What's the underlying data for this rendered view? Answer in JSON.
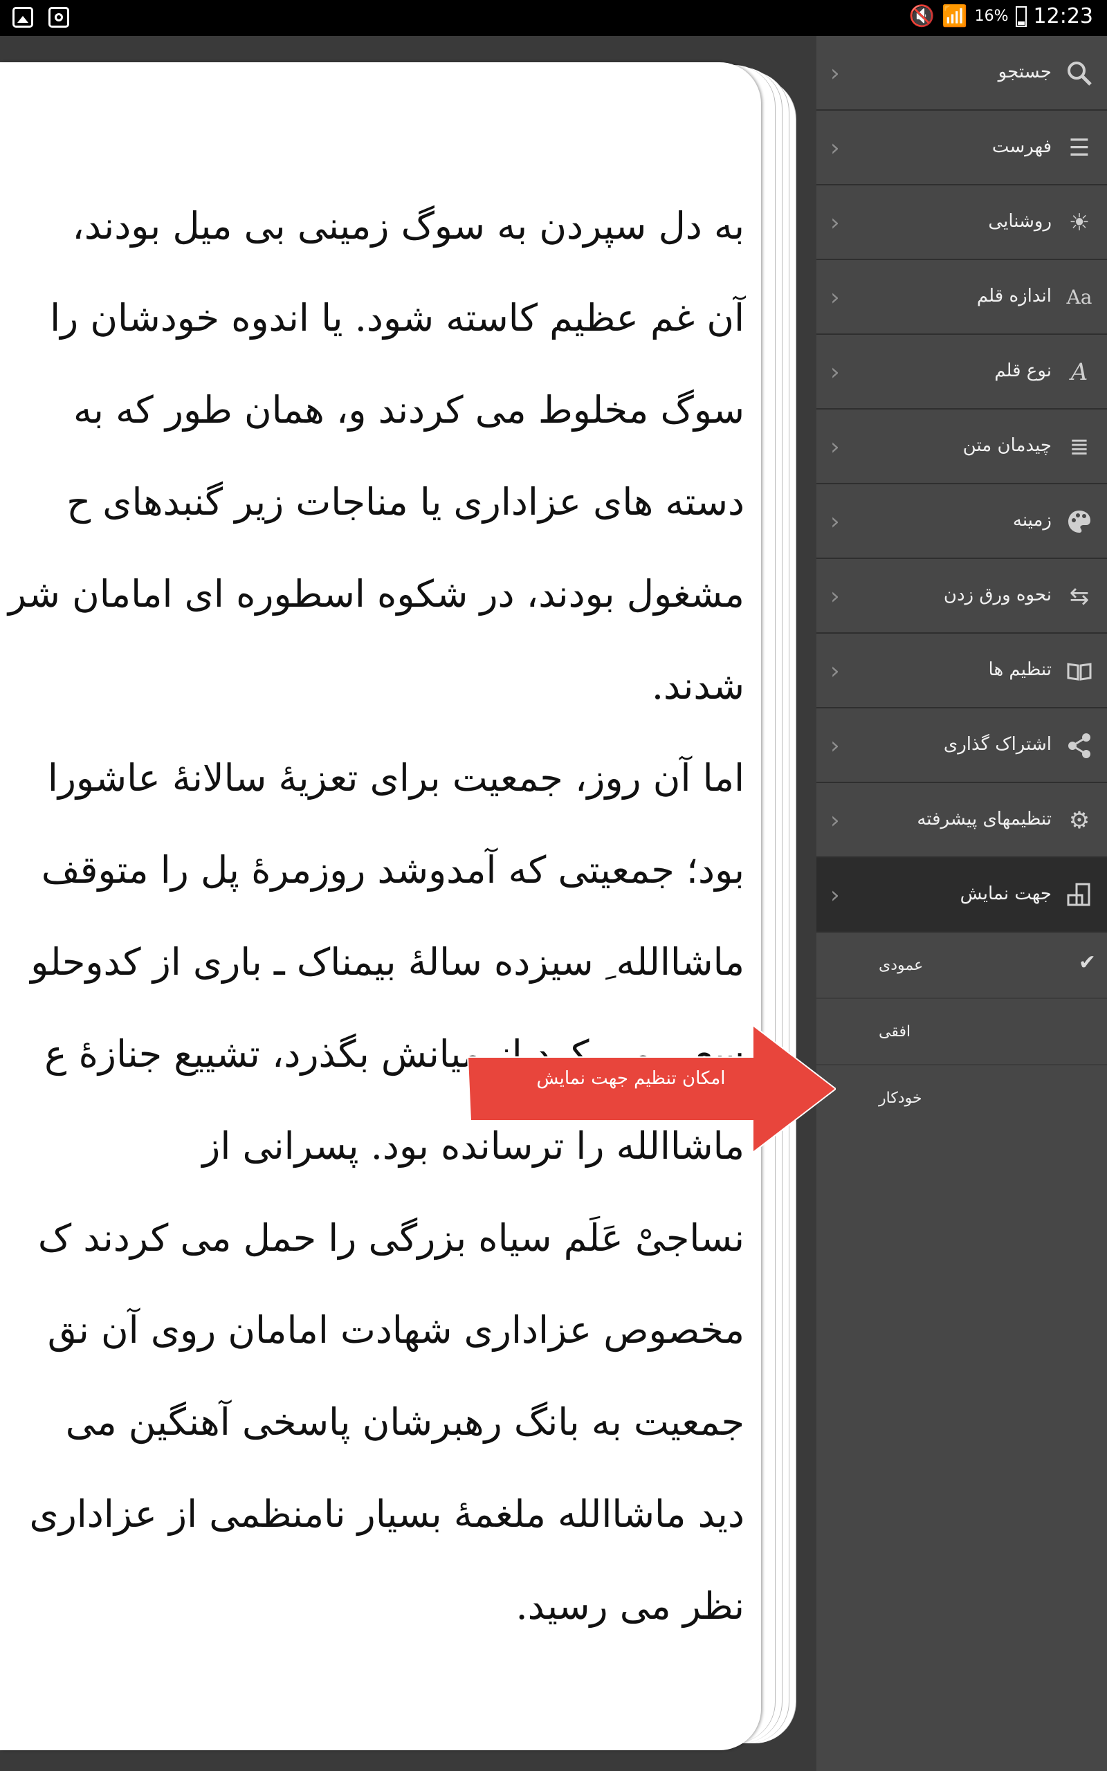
{
  "status_bar": {
    "battery": "16%",
    "time": "12:23"
  },
  "book": {
    "lines": [
      "به دل سپردن به سوگ زمینی بی میل بودند،",
      "آن غم عظیم کاسته شود. یا اندوه خودشان را",
      "سوگ مخلوط می کردند و، همان طور که به",
      "دسته های عزاداری یا مناجات زیر گنبدهای ح",
      "مشغول بودند، در شکوه اسطوره ای امامان شر",
      "شدند.",
      "اما آن روز، جمعیت برای تعزیهٔ سالانهٔ عاشورا",
      "بود؛ جمعیتی که آمدوشد روزمرهٔ پل را متوقف",
      "ماشاالله ِ سیزده سالهٔ بیمناک ـ باری از کدوحلو",
      "سعی می کرد از میانش بگذرد، تشییع جنازهٔ ع",
      "ماشاالله را ترسانده بود. پسرانی از",
      "نساجیْ عَلَم سیاه بزرگی را حمل می کردند ک",
      "مخصوص عزاداری شهادت امامان روی آن نق",
      "جمعیت به بانگ رهبرشان پاسخی آهنگین می",
      "دید ماشاالله ملغمهٔ بسیار نامنظمی از عزاداری",
      "نظر می رسید."
    ]
  },
  "sidebar": {
    "items": [
      {
        "label": "جستجو",
        "icon": "search-icon"
      },
      {
        "label": "فهرست",
        "icon": "list-icon"
      },
      {
        "label": "روشنایی",
        "icon": "brightness-icon"
      },
      {
        "label": "اندازه قلم",
        "icon": "font-size-icon"
      },
      {
        "label": "نوع قلم",
        "icon": "font-type-icon"
      },
      {
        "label": "چیدمان متن",
        "icon": "text-align-icon"
      },
      {
        "label": "زمینه",
        "icon": "palette-icon"
      },
      {
        "label": "نحوه ورق زدن",
        "icon": "page-turn-icon"
      },
      {
        "label": "تنظیم ها",
        "icon": "book-icon"
      },
      {
        "label": "اشتراک گذاری",
        "icon": "share-icon"
      },
      {
        "label": "تنظیمهای پیشرفته",
        "icon": "gear-icon"
      },
      {
        "label": "جهت نمایش",
        "icon": "orientation-icon"
      }
    ],
    "orientation_options": [
      {
        "label": "عمودی",
        "selected": true
      },
      {
        "label": "افقی",
        "selected": false
      },
      {
        "label": "خودکار",
        "selected": false
      }
    ]
  },
  "callout": {
    "label": "امکان تنظیم جهت نمایش",
    "color": "#e8453c"
  },
  "colors": {
    "sidebar_bg": "#474747",
    "active_bg": "#2c2c2c"
  }
}
